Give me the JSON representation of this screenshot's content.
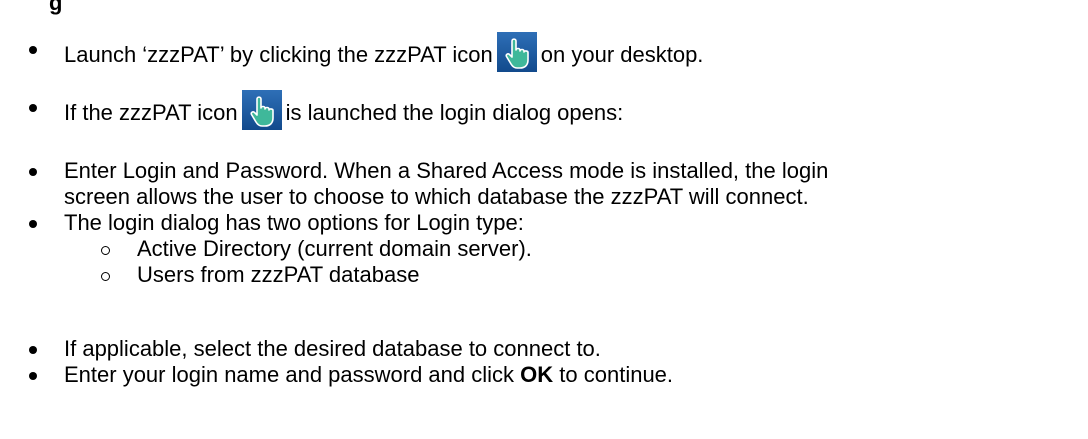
{
  "heading_fragment": "g",
  "bullets": [
    {
      "before": "Launch ‘zzzPAT’ by clicking the zzzPAT icon",
      "after": "on your desktop."
    },
    {
      "before": "If the zzzPAT icon",
      "after": "is launched the login dialog opens:"
    },
    {
      "line1": "Enter Login and Password. When a Shared Access mode is installed, the login",
      "line2": "screen allows the user to choose to which database the zzzPAT will connect."
    },
    {
      "text": "The login dialog has two options for Login type:"
    },
    {
      "text": "If applicable, select the desired database to connect to."
    },
    {
      "before": "Enter your login name and password and click",
      "bold": "OK",
      "after": "to continue."
    }
  ],
  "sub_options": [
    "Active Directory (current domain server).",
    "Users from zzzPAT database"
  ],
  "icon": {
    "name": "zzzpat-hand-icon",
    "colors": {
      "background_top": "#2e6fb7",
      "background_bottom": "#124a8c",
      "hand": "#3fb89a",
      "outline": "#ffffff"
    }
  }
}
